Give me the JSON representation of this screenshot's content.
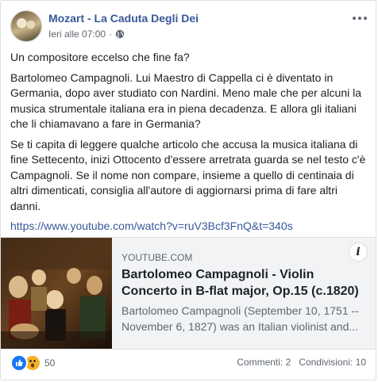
{
  "post": {
    "page_name": "Mozart - La Caduta Degli Dei",
    "timestamp": "Ieri alle 07:00",
    "separator": "·",
    "privacy_icon": "globe-icon",
    "more_icon": "ellipsis-icon",
    "paragraphs": [
      "Un compositore eccelso che fine fa?",
      "Bartolomeo Campagnoli. Lui Maestro di Cappella ci è diventato in Germania, dopo aver studiato con Nardini. Meno male che per alcuni la musica strumentale italiana era in piena decadenza. E allora gli italiani che li chiamavano a fare in Germania?",
      "Se ti capita di leggere qualche articolo che accusa la musica italiana di fine Settecento, inizi Ottocento d'essere arretrata guarda se nel testo c'è Campagnoli. Se il nome non compare, insieme a quello di centinaia di altri dimenticati, consiglia all'autore di aggiornarsi prima di fare altri danni."
    ],
    "link": "https://www.youtube.com/watch?v=ruV3Bcf3FnQ&t=340s"
  },
  "attachment": {
    "source": "YOUTUBE.COM",
    "title": "Bartolomeo Campagnoli - Violin Concerto in B-flat major, Op.15 (c.1820)",
    "description": "Bartolomeo Campagnoli (September 10, 1751 -- November 6, 1827) was an Italian violinist and...",
    "info_label": "i"
  },
  "footer": {
    "reaction_icons": [
      "like-icon",
      "wow-icon"
    ],
    "reaction_count": "50",
    "comments": "Commenti: 2",
    "shares": "Condivisioni: 10"
  },
  "colors": {
    "link": "#385898",
    "like": "#1877f2",
    "wow": "#f7b125"
  }
}
